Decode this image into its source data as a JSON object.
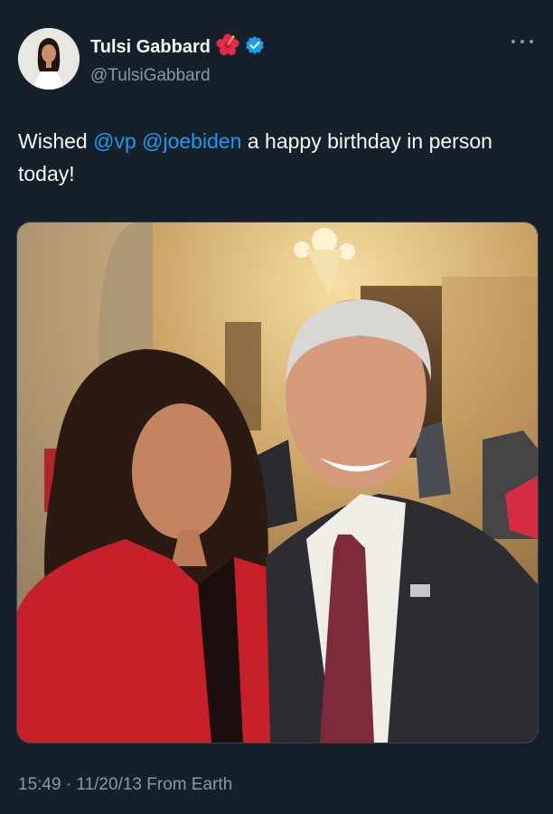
{
  "tweet": {
    "author": {
      "display_name": "Tulsi Gabbard",
      "handle": "@TulsiGabbard",
      "verified": true,
      "emoji": "hibiscus"
    },
    "text": {
      "lead": "Wished ",
      "mention1": "@vp",
      "space": " ",
      "mention2": "@joebiden",
      "tail": " a happy birthday in person today!"
    },
    "timestamp": "15:49 · 11/20/13 From Earth",
    "media": {
      "description_icon": "photo"
    }
  },
  "colors": {
    "background": "#15202b",
    "mention": "#1d9bf0",
    "verified": "#1d9bf0",
    "muted": "#8b98a5"
  }
}
